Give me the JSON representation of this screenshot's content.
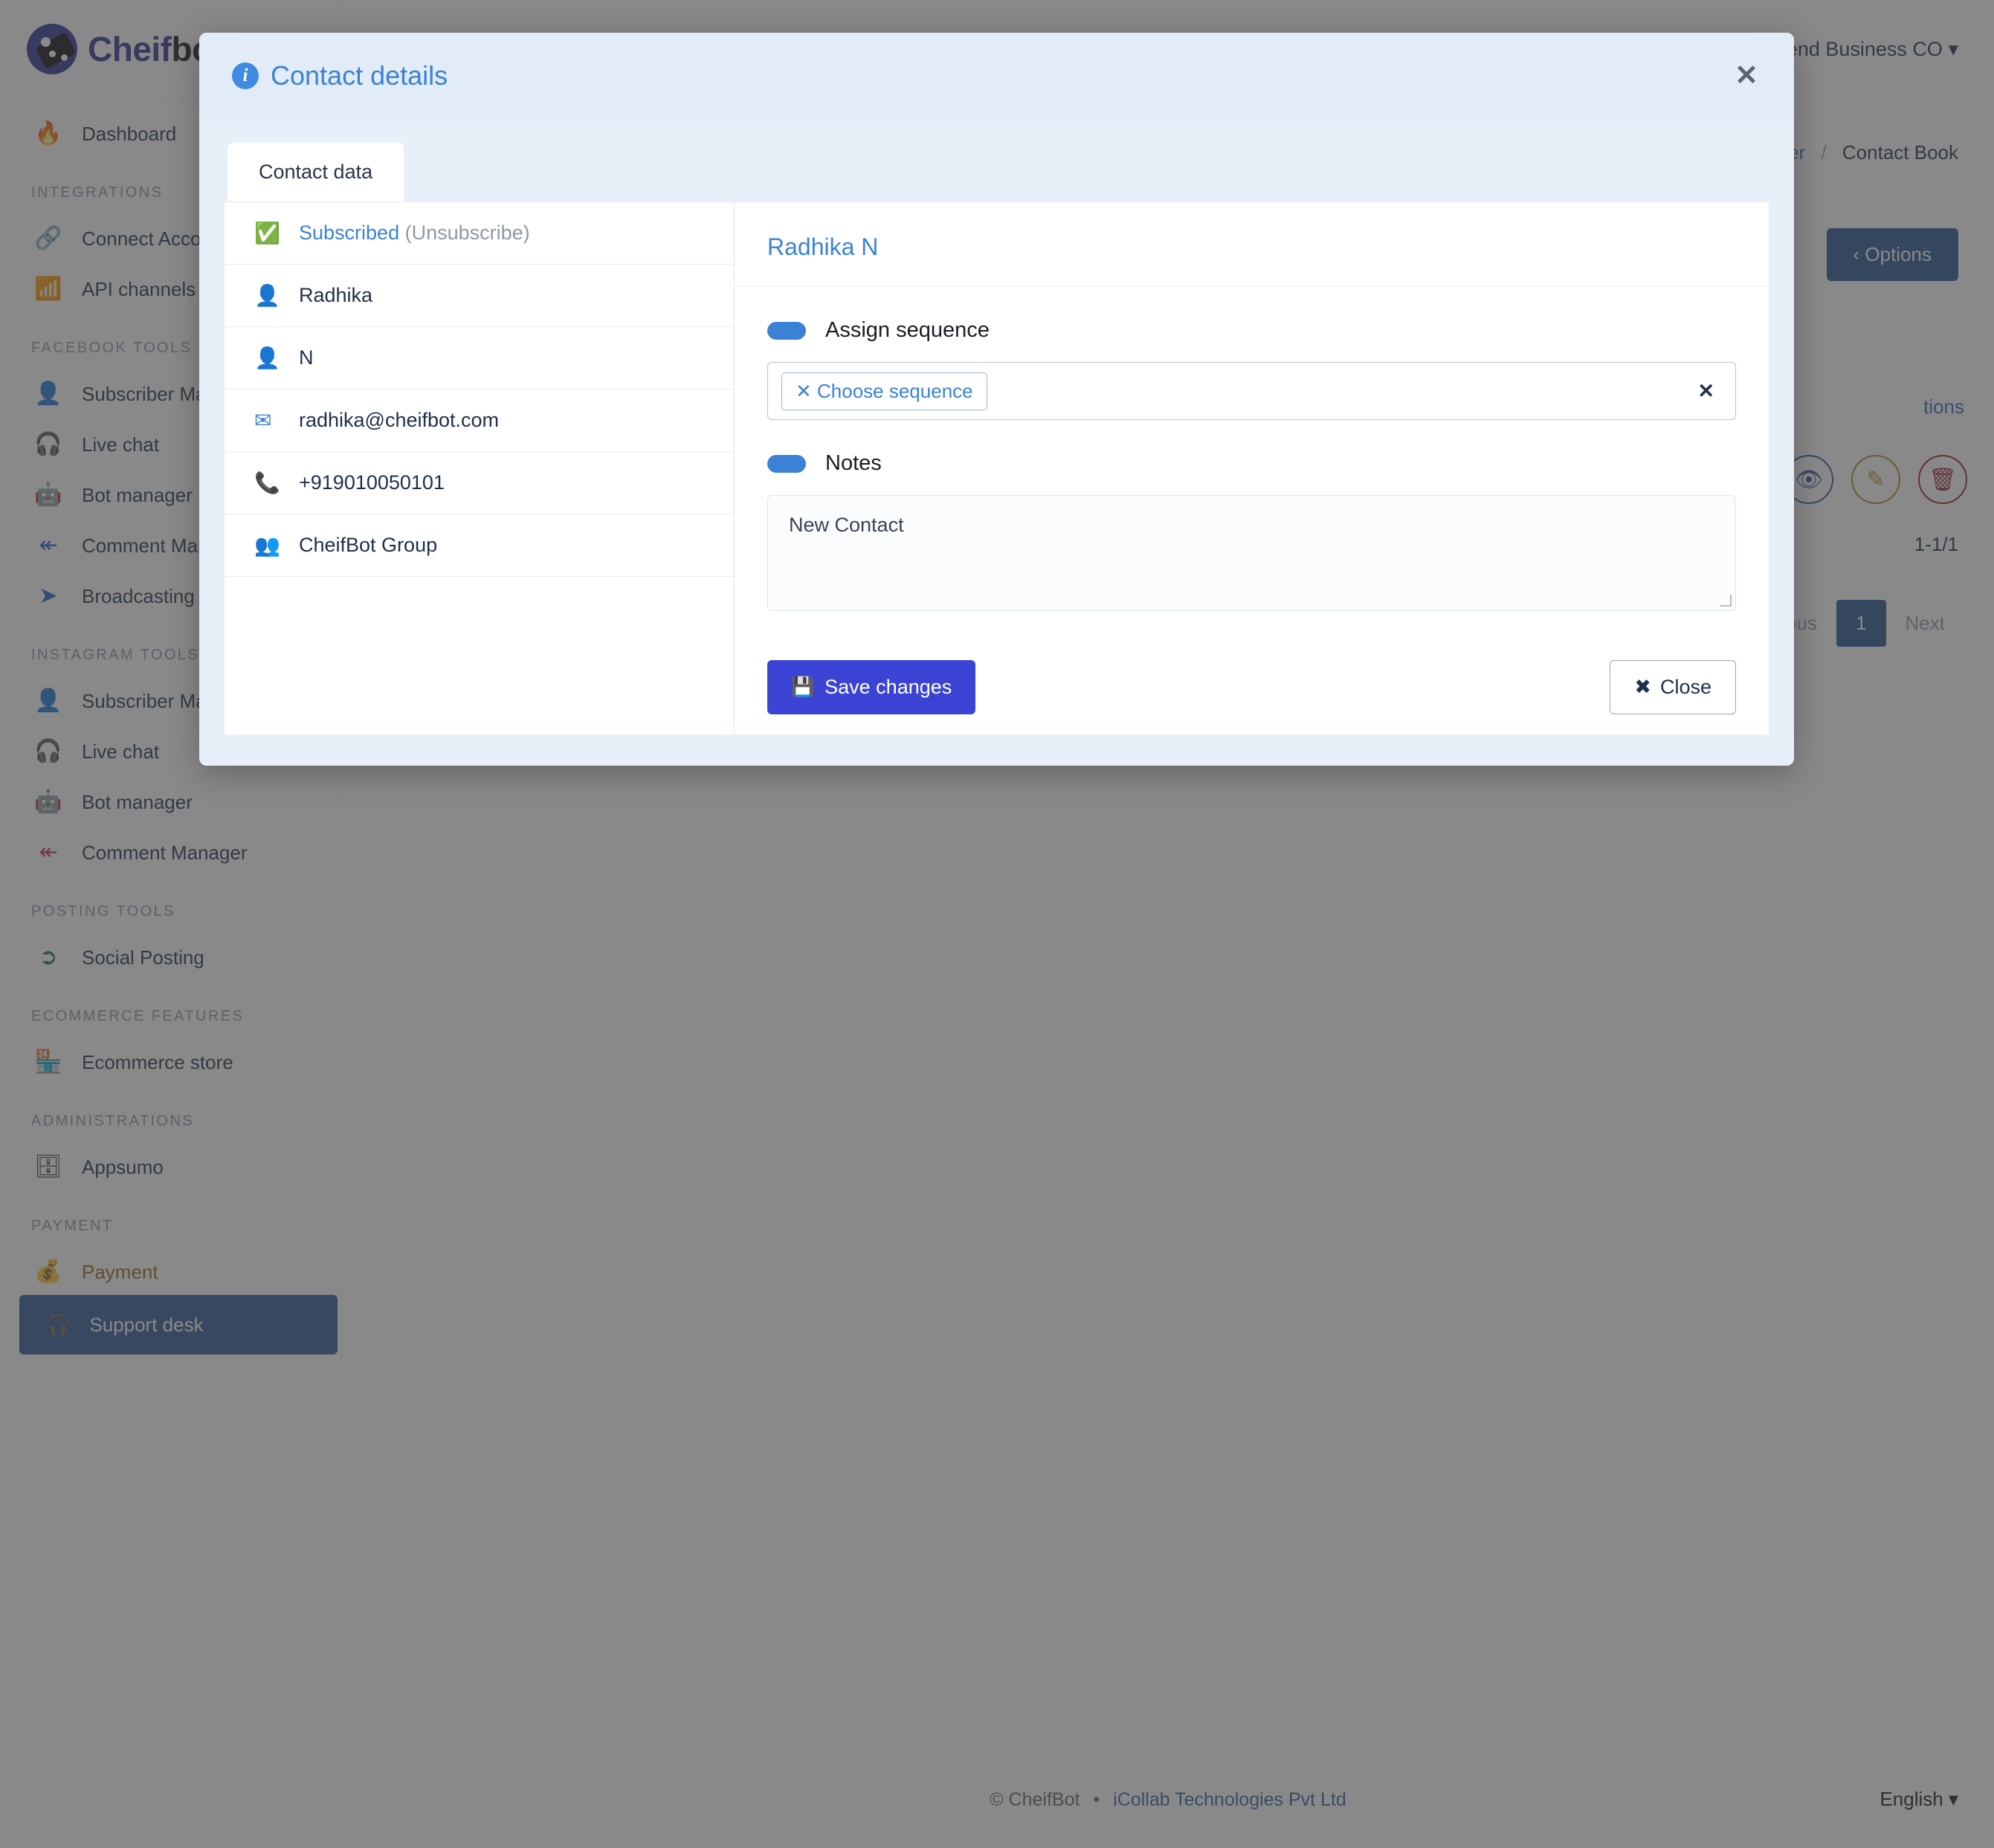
{
  "app": {
    "brand_primary": "Cheif",
    "brand_secondary": "bot",
    "accent_blue": "#3b82d6",
    "primary_button": "#3b43d4",
    "header_bg": "#e1ecf7"
  },
  "topbar": {
    "account_name": "Trend Business CO",
    "account_caret": "▾",
    "avatar_icon": "user-avatar-icon"
  },
  "breadcrumb": {
    "parent": "anager",
    "separator": "/",
    "current": "Contact Book"
  },
  "page": {
    "options_button": "‹ Options",
    "actions_header": "tions",
    "range_count": "1-1/1",
    "row_action_icons": [
      "eye-icon",
      "pencil-icon",
      "trash-icon"
    ],
    "pager": {
      "previous": "vious",
      "current_page": "1",
      "next": "Next"
    }
  },
  "sidebar": {
    "dashboard": {
      "label": "Dashboard",
      "icon": "flame-icon"
    },
    "sections": [
      {
        "label": "INTEGRATIONS",
        "items": [
          {
            "label": "Connect Acco",
            "icon": "link-icon",
            "color_class": "ic-green"
          },
          {
            "label": "API channels",
            "icon": "wifi-icon",
            "color_class": "ic-green"
          }
        ]
      },
      {
        "label": "FACEBOOK TOOLS",
        "items": [
          {
            "label": "Subscriber Ma",
            "icon": "user-circle-icon",
            "color_class": "ic-blue"
          },
          {
            "label": "Live chat",
            "icon": "headset-icon",
            "color_class": "ic-blue"
          },
          {
            "label": "Bot manager",
            "icon": "robot-icon",
            "color_class": "ic-blue"
          },
          {
            "label": "Comment Mar",
            "icon": "reply-all-icon",
            "color_class": "ic-blue"
          },
          {
            "label": "Broadcasting",
            "icon": "paper-plane-icon",
            "color_class": "ic-blue"
          }
        ]
      },
      {
        "label": "INSTAGRAM TOOLS",
        "items": [
          {
            "label": "Subscriber Ma",
            "icon": "user-circle-icon",
            "color_class": "ic-pink"
          },
          {
            "label": "Live chat",
            "icon": "headset-icon",
            "color_class": "ic-pink"
          },
          {
            "label": "Bot manager",
            "icon": "robot-icon",
            "color_class": "ic-pink"
          },
          {
            "label": "Comment Manager",
            "icon": "reply-all-icon",
            "color_class": "ic-pink"
          }
        ]
      },
      {
        "label": "POSTING TOOLS",
        "items": [
          {
            "label": "Social Posting",
            "icon": "share-square-icon",
            "color_class": "ic-green"
          }
        ]
      },
      {
        "label": "ECOMMERCE FEATURES",
        "items": [
          {
            "label": "Ecommerce store",
            "icon": "store-icon",
            "color_class": "ic-red"
          }
        ]
      },
      {
        "label": "ADMINISTRATIONS",
        "items": [
          {
            "label": "Appsumo",
            "icon": "id-card-icon",
            "color_class": "ic-dark"
          }
        ]
      },
      {
        "label": "PAYMENT",
        "items": [
          {
            "label": "Payment",
            "icon": "coins-icon",
            "color_class": "ic-gold",
            "text_class": "txt-gold"
          }
        ]
      }
    ],
    "support_desk": {
      "label": "Support desk",
      "icon": "headset-icon"
    }
  },
  "footer": {
    "copyright": "© CheifBot",
    "dot": "•",
    "company": "iCollab Technologies Pvt Ltd",
    "language": "English ▾"
  },
  "modal": {
    "title": "Contact details",
    "title_icon": "info-circle-icon",
    "close_x": "✕",
    "tab": "Contact data",
    "contact_rows": [
      {
        "icon": "check-circle-icon",
        "text": "Subscribed",
        "suffix": "(Unsubscribe)",
        "link": true
      },
      {
        "icon": "user-icon",
        "text": "Radhika",
        "suffix": "",
        "link": false
      },
      {
        "icon": "user-circle-icon",
        "text": "N",
        "suffix": "",
        "link": false
      },
      {
        "icon": "envelope-icon",
        "text": "radhika@cheifbot.com",
        "suffix": "",
        "link": false
      },
      {
        "icon": "phone-icon",
        "text": "+919010050101",
        "suffix": "",
        "link": false
      },
      {
        "icon": "users-icon",
        "text": "CheifBot Group",
        "suffix": "",
        "link": false
      }
    ],
    "detail": {
      "name": "Radhika N",
      "assign_sequence_label": "Assign sequence",
      "assign_sequence_on": true,
      "sequence_chip": "✕ Choose sequence",
      "sequence_clear": "✕",
      "notes_label": "Notes",
      "notes_on": true,
      "notes_value": "New Contact"
    },
    "save_button": "Save changes",
    "save_icon": "floppy-disk-icon",
    "close_button": "Close",
    "close_icon": "x-icon"
  }
}
